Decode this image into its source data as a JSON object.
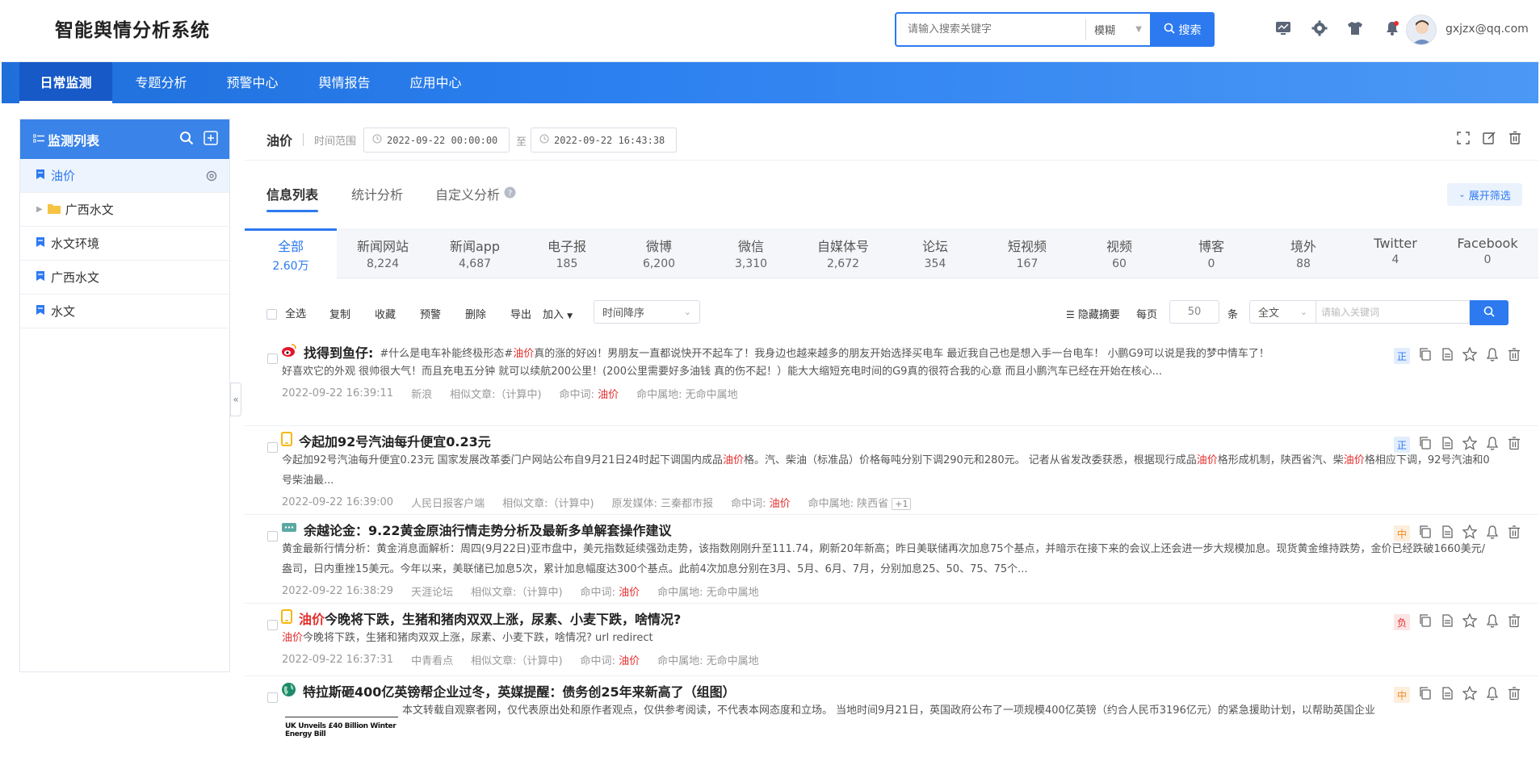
{
  "header": {
    "app_title": "智能舆情分析系统",
    "search_placeholder": "请输入搜索关键字",
    "search_mode": "模糊",
    "search_button": "搜索",
    "icons": [
      "chart-icon",
      "gear-icon",
      "shirt-icon",
      "bell-icon"
    ],
    "user_email": "gxjzx@qq.com"
  },
  "nav": {
    "tabs": [
      {
        "label": "日常监测",
        "active": true
      },
      {
        "label": "专题分析"
      },
      {
        "label": "预警中心"
      },
      {
        "label": "舆情报告"
      },
      {
        "label": "应用中心"
      }
    ]
  },
  "sidebar": {
    "title": "监测列表",
    "items": [
      {
        "label": "油价",
        "active": true
      },
      {
        "label": "广西水文",
        "folder": true
      },
      {
        "label": "水文环境"
      },
      {
        "label": "广西水文"
      },
      {
        "label": "水文"
      }
    ],
    "collapse_glyph": "«"
  },
  "topic": {
    "name": "油价",
    "time_label": "时间范围",
    "start": "2022-09-22 00:00:00",
    "to": "至",
    "end": "2022-09-22 16:43:38"
  },
  "subtabs": {
    "items": [
      "信息列表",
      "统计分析",
      "自定义分析"
    ],
    "expand_filter": "展开筛选"
  },
  "source_tabs": [
    {
      "label": "全部",
      "count": "2.60万",
      "active": true
    },
    {
      "label": "新闻网站",
      "count": "8,224"
    },
    {
      "label": "新闻app",
      "count": "4,687"
    },
    {
      "label": "电子报",
      "count": "185"
    },
    {
      "label": "微博",
      "count": "6,200"
    },
    {
      "label": "微信",
      "count": "3,310"
    },
    {
      "label": "自媒体号",
      "count": "2,672"
    },
    {
      "label": "论坛",
      "count": "354"
    },
    {
      "label": "短视频",
      "count": "167"
    },
    {
      "label": "视频",
      "count": "60"
    },
    {
      "label": "博客",
      "count": "0"
    },
    {
      "label": "境外",
      "count": "88"
    },
    {
      "label": "Twitter",
      "count": "4"
    },
    {
      "label": "Facebook",
      "count": "0"
    }
  ],
  "toolbar": {
    "select_all": "全选",
    "copy": "复制",
    "favorite": "收藏",
    "warn": "预警",
    "delete": "删除",
    "export": "导出",
    "join": "加入",
    "sort": "时间降序",
    "hide_summary": "隐藏摘要",
    "per_page": "每页",
    "page_size": "50",
    "unit": "条",
    "scope": "全文",
    "kw_placeholder": "请输入关键词"
  },
  "items": [
    {
      "source_icon": "weibo-icon",
      "title": "找得到鱼仔:",
      "title_tail_a": "#什么是电车补能终极形态#",
      "title_tail_hl": "油价",
      "title_tail_b": "真的涨的好凶！男朋友一直都说快开不起车了！我身边也越来越多的朋友开始选择买电车 最近我自己也是想入手一台电车！ 小鹏G9可以说是我的梦中情车了！",
      "body": "好喜欢它的外观 很帅很大气！而且充电五分钟 就可以续航200公里！(200公里需要好多油钱 真的伤不起！）能大大缩短充电时间的G9真的很符合我的心意 而且小鹏汽车已经在开始在核心...",
      "time": "2022-09-22 16:39:11",
      "source": "新浪",
      "similar": "相似文章:（计算中)",
      "hit_label": "命中词:",
      "hit": "油价",
      "place": "命中属地:   无命中属地",
      "sentiment": "正"
    },
    {
      "source_icon": "app-icon",
      "title": "今起加92号汽油每升便宜0.23元",
      "body_a": "今起加92号汽油每升便宜0.23元        国家发展改革委门户网站公布自9月21日24时起下调国内成品",
      "body_hl1": "油价",
      "body_b": "格。汽、柴油（标准品）价格每吨分别下调290元和280元。        记者从省发改委获悉，根据现行成品",
      "body_hl2": "油价",
      "body_c": "格形成机制，陕西省汽、柴",
      "body_hl3": "油价",
      "body_d": "格相应下调，92号汽油和0号柴油最...",
      "time": "2022-09-22 16:39:00",
      "source": "人民日报客户端",
      "similar": "相似文章:（计算中)",
      "origin": "原发媒体:   三秦都市报",
      "hit_label": "命中词:",
      "hit": "油价",
      "place": "命中属地:   陕西省",
      "plus": "+1",
      "sentiment": "正"
    },
    {
      "source_icon": "forum-icon",
      "title": "余越论金：9.22黄金原油行情走势分析及最新多单解套操作建议",
      "body": "黄金最新行情分析：黄金消息面解析：周四(9月22日)亚市盘中，美元指数延续强劲走势，该指数刚刚升至111.74，刷新20年新高；昨日美联储再次加息75个基点，并暗示在接下来的会议上还会进一步大规模加息。现货黄金维持跌势，金价已经跌破1660美元/盎司，日内重挫15美元。今年以来，美联储已加息5次，累计加息幅度达300个基点。此前4次加息分别在3月、5月、6月、7月，分别加息25、50、75、75个...",
      "time": "2022-09-22 16:38:29",
      "source": "天涯论坛",
      "similar": "相似文章:（计算中)",
      "hit_label": "命中词:",
      "hit": "油价",
      "place": "命中属地:   无命中属地",
      "sentiment": "中"
    },
    {
      "source_icon": "app-icon",
      "title_hl": "油价",
      "title": "今晚将下跌，生猪和猪肉双双上涨，尿素、小麦下跌，啥情况?",
      "body_hl": "油价",
      "body": "今晚将下跌，生猪和猪肉双双上涨，尿素、小麦下跌，啥情况?        url redirect",
      "time": "2022-09-22 16:37:31",
      "source": "中青看点",
      "similar": "相似文章:（计算中)",
      "hit_label": "命中词:",
      "hit": "油价",
      "place": "命中属地:   无命中属地",
      "sentiment": "负"
    },
    {
      "source_icon": "globe-icon",
      "title": "特拉斯砸400亿英镑帮企业过冬，英媒提醒：债务创25年来新高了（组图）",
      "thumb": "UK Unveils £40 Billion Winter Energy Bill",
      "body": "本文转载自观察者网，仅代表原出处和原作者观点，仅供参考阅读，不代表本网态度和立场。     当地时间9月21日，英国政府公布了一项规模400亿英镑（约合人民币3196亿元）的紧急援助计划，以帮助英国企业",
      "sentiment": "中"
    }
  ],
  "colors": {
    "primary": "#2d7af0",
    "highlight": "#e52d2d",
    "positive": "#2d7af0",
    "neutral": "#f08a24",
    "negative": "#e52d2d"
  }
}
